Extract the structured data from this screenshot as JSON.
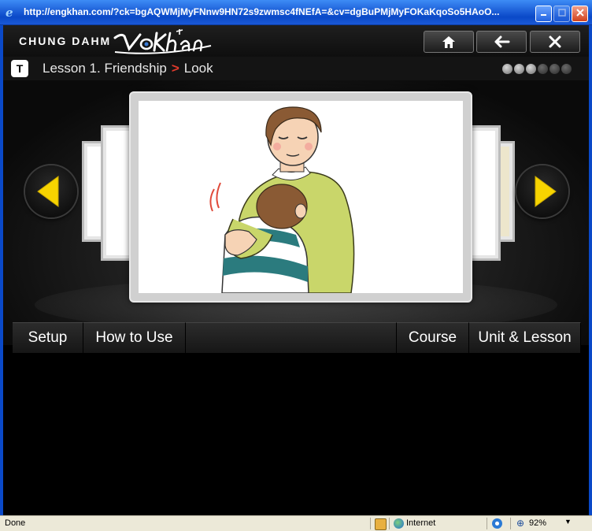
{
  "window": {
    "url_title": "http://engkhan.com/?ck=bgAQWMjMyFNnw9HN72s9zwmsc4fNEfA=&cv=dgBuPMjMyFOKaKqoSo5HAoO..."
  },
  "header": {
    "brand": "CHUNG DAHM",
    "logo_text": "VoKhan",
    "home_icon": "home-icon",
    "back_icon": "arrow-left-icon",
    "close_icon": "close-icon"
  },
  "breadcrumb": {
    "badge": "T",
    "lesson": "Lesson 1. Friendship",
    "section": "Look",
    "separator": ">"
  },
  "progress": {
    "current": 3,
    "total": 6
  },
  "nav": {
    "prev_icon": "arrow-left-triangle-icon",
    "next_icon": "arrow-right-triangle-icon"
  },
  "tabs": {
    "setup": "Setup",
    "how_to_use": "How to Use",
    "course": "Course",
    "unit_lesson": "Unit & Lesson"
  },
  "statusbar": {
    "status": "Done",
    "zone": "Internet",
    "zoom": "92%"
  },
  "colors": {
    "accent_yellow": "#f7d400",
    "breadcrumb_sep": "#e03a2c",
    "titlebar": "#1d5fd8"
  }
}
